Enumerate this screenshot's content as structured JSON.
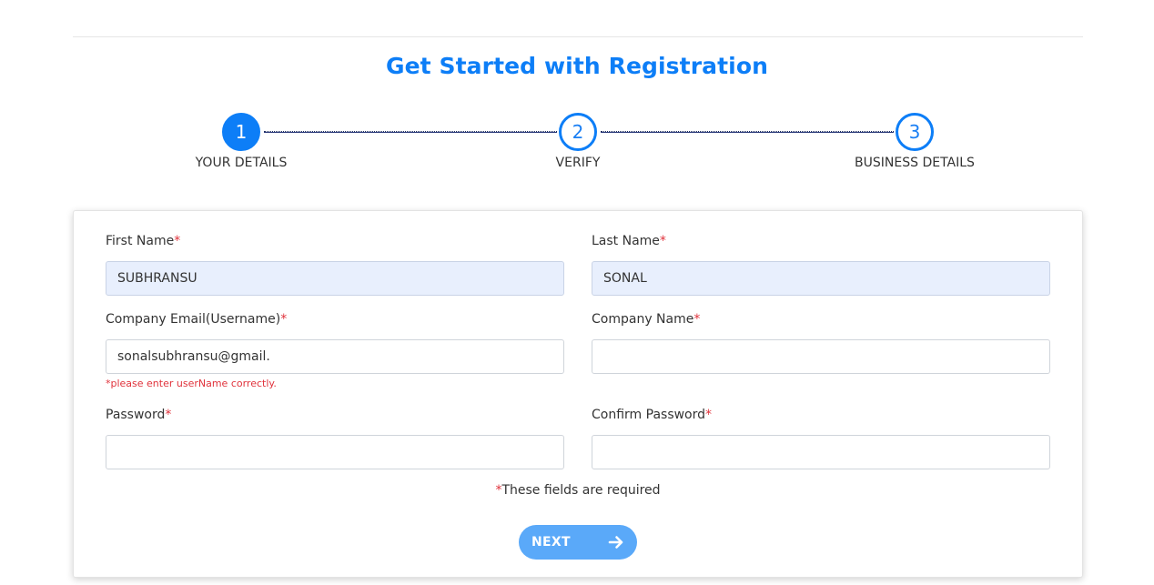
{
  "page": {
    "title": "Get Started with Registration"
  },
  "stepper": {
    "steps": [
      {
        "number": "1",
        "label": "YOUR DETAILS",
        "active": true
      },
      {
        "number": "2",
        "label": "VERIFY",
        "active": false
      },
      {
        "number": "3",
        "label": "BUSINESS DETAILS",
        "active": false
      }
    ]
  },
  "form": {
    "required_marker": "*",
    "first_name": {
      "label": "First Name",
      "value": "SUBHRANSU"
    },
    "last_name": {
      "label": "Last Name",
      "value": "SONAL"
    },
    "company_email": {
      "label": "Company Email(Username)",
      "value": "sonalsubhransu@gmail.",
      "error": "*please enter userName correctly."
    },
    "company_name": {
      "label": "Company Name",
      "value": ""
    },
    "password": {
      "label": "Password",
      "value": ""
    },
    "confirm_password": {
      "label": "Confirm Password",
      "value": ""
    },
    "required_note": "These fields are required",
    "next_label": "NEXT"
  },
  "colors": {
    "accent": "#0d7ef7",
    "error": "#e0323b",
    "autofill_bg": "#e8effd",
    "button_bg": "#5aa9f9"
  },
  "icons": {
    "next_button": "arrow-right-icon"
  }
}
